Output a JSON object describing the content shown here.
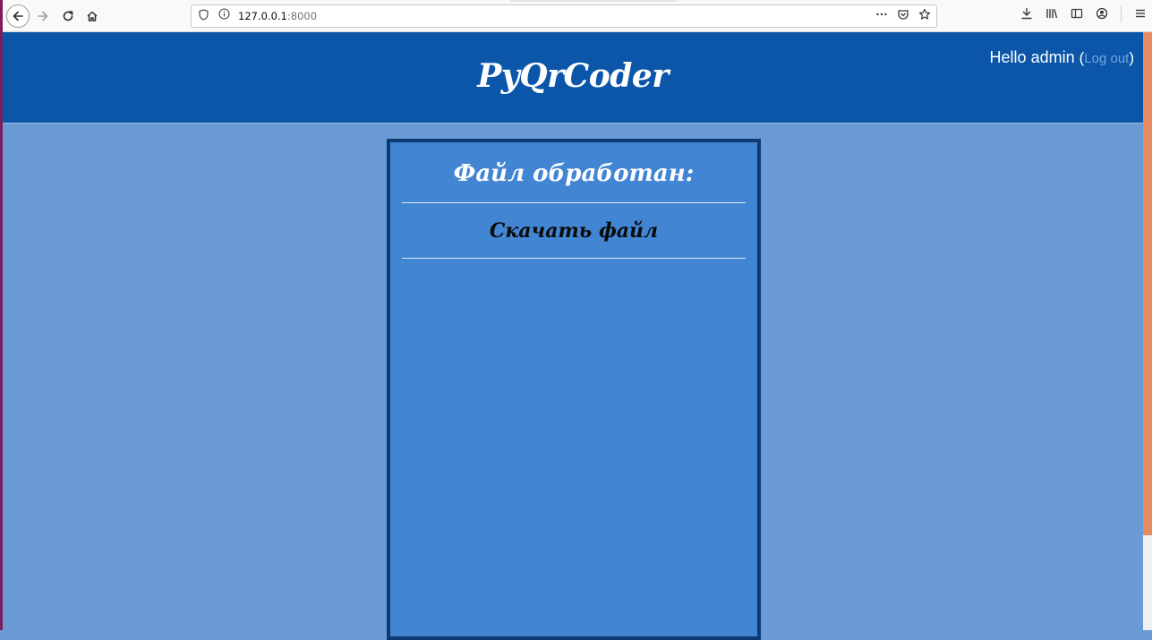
{
  "browser": {
    "url_host": "127.0.0.1",
    "url_port": ":8000",
    "icons": {
      "back": "back-arrow-icon",
      "forward": "forward-arrow-icon",
      "reload": "reload-icon",
      "home": "home-icon",
      "shield": "tracking-shield-icon",
      "info": "site-info-icon",
      "page_actions": "more-actions-icon",
      "pocket": "pocket-icon",
      "bookmark": "bookmark-star-icon",
      "downloads": "downloads-icon",
      "library": "library-icon",
      "sidebar": "sidebar-icon",
      "account": "account-icon",
      "menu": "hamburger-menu-icon"
    }
  },
  "header": {
    "title": "PyQrCoder",
    "greeting": "Hello admin",
    "paren_open": "(",
    "logout_label": "Log out",
    "paren_close": ")"
  },
  "panel": {
    "title": "Файл обработан:",
    "download_label": "Скачать файл"
  },
  "colors": {
    "header_bg": "#0b56a8",
    "page_bg": "#6a9bd4",
    "panel_bg": "#4285d3",
    "panel_border": "#0d3a73",
    "logout_link": "#6fa7e0"
  }
}
